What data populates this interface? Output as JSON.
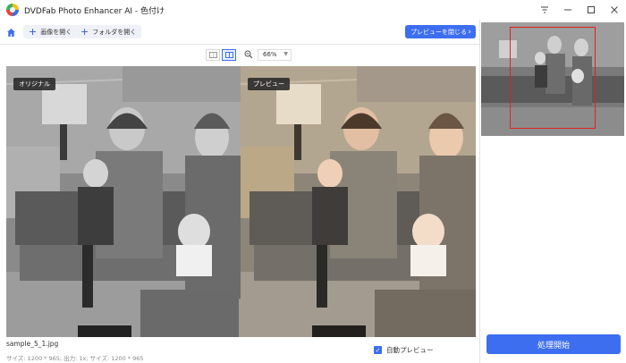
{
  "window": {
    "title": "DVDFab Photo Enhancer AI - 色付け",
    "controls": [
      "filter-icon",
      "minimize-icon",
      "maximize-icon",
      "close-icon"
    ]
  },
  "toolbar": {
    "open_image_label": "画像を開く",
    "open_folder_label": "フォルダを開く",
    "open_preview_label": "プレビューを閉じる",
    "accent": "#3d6ef0"
  },
  "view": {
    "zoom_value": "66%"
  },
  "panes": {
    "original_label": "オリジナル",
    "preview_label": "プレビュー"
  },
  "file": {
    "name": "sample_5_1.jpg",
    "size_info": "サイズ: 1200 * 965; 出力: 1x; サイズ: 1200 * 965"
  },
  "auto_preview": {
    "label": "自動プレビュー",
    "checked": true
  },
  "process": {
    "label": "処理開始"
  }
}
